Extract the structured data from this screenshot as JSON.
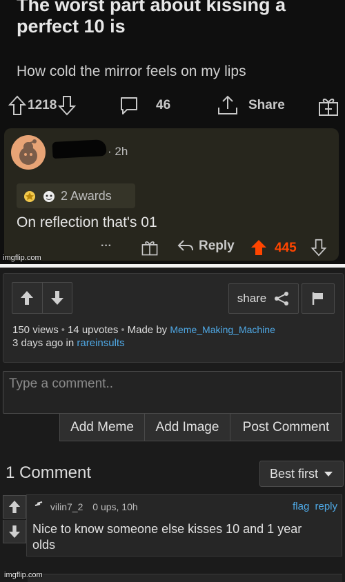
{
  "meme": {
    "post_title": "The worst part about kissing a perfect 10 is",
    "post_body": "How cold the mirror feels on my lips",
    "upvotes": "1218",
    "comments": "46",
    "share_label": "Share",
    "comment": {
      "time": "2h",
      "awards_label": "2 Awards",
      "text": "On reflection that's 01",
      "more": "···",
      "reply_label": "Reply",
      "score": "445"
    },
    "watermark": "imgflip.com"
  },
  "post": {
    "share_label": "share",
    "views": "150 views",
    "upvotes": "14 upvotes",
    "made_by_prefix": "Made by",
    "author": "Meme_Making_Machine",
    "posted": "3 days ago in",
    "stream": "rareinsults"
  },
  "comment_form": {
    "placeholder": "Type a comment..",
    "add_meme": "Add Meme",
    "add_image": "Add Image",
    "post_comment": "Post Comment"
  },
  "comments_section": {
    "count_label": "1 Comment",
    "sort_label": "Best first",
    "items": [
      {
        "username": "vilin7_2",
        "meta": "0 ups, 10h",
        "flag": "flag",
        "reply": "reply",
        "text": "Nice to know someone else kisses 10 and 1 year olds"
      }
    ]
  },
  "footer_watermark": "imgflip.com",
  "colors": {
    "accent_link": "#4fa9e6",
    "upvote_orange": "#ff4500"
  }
}
